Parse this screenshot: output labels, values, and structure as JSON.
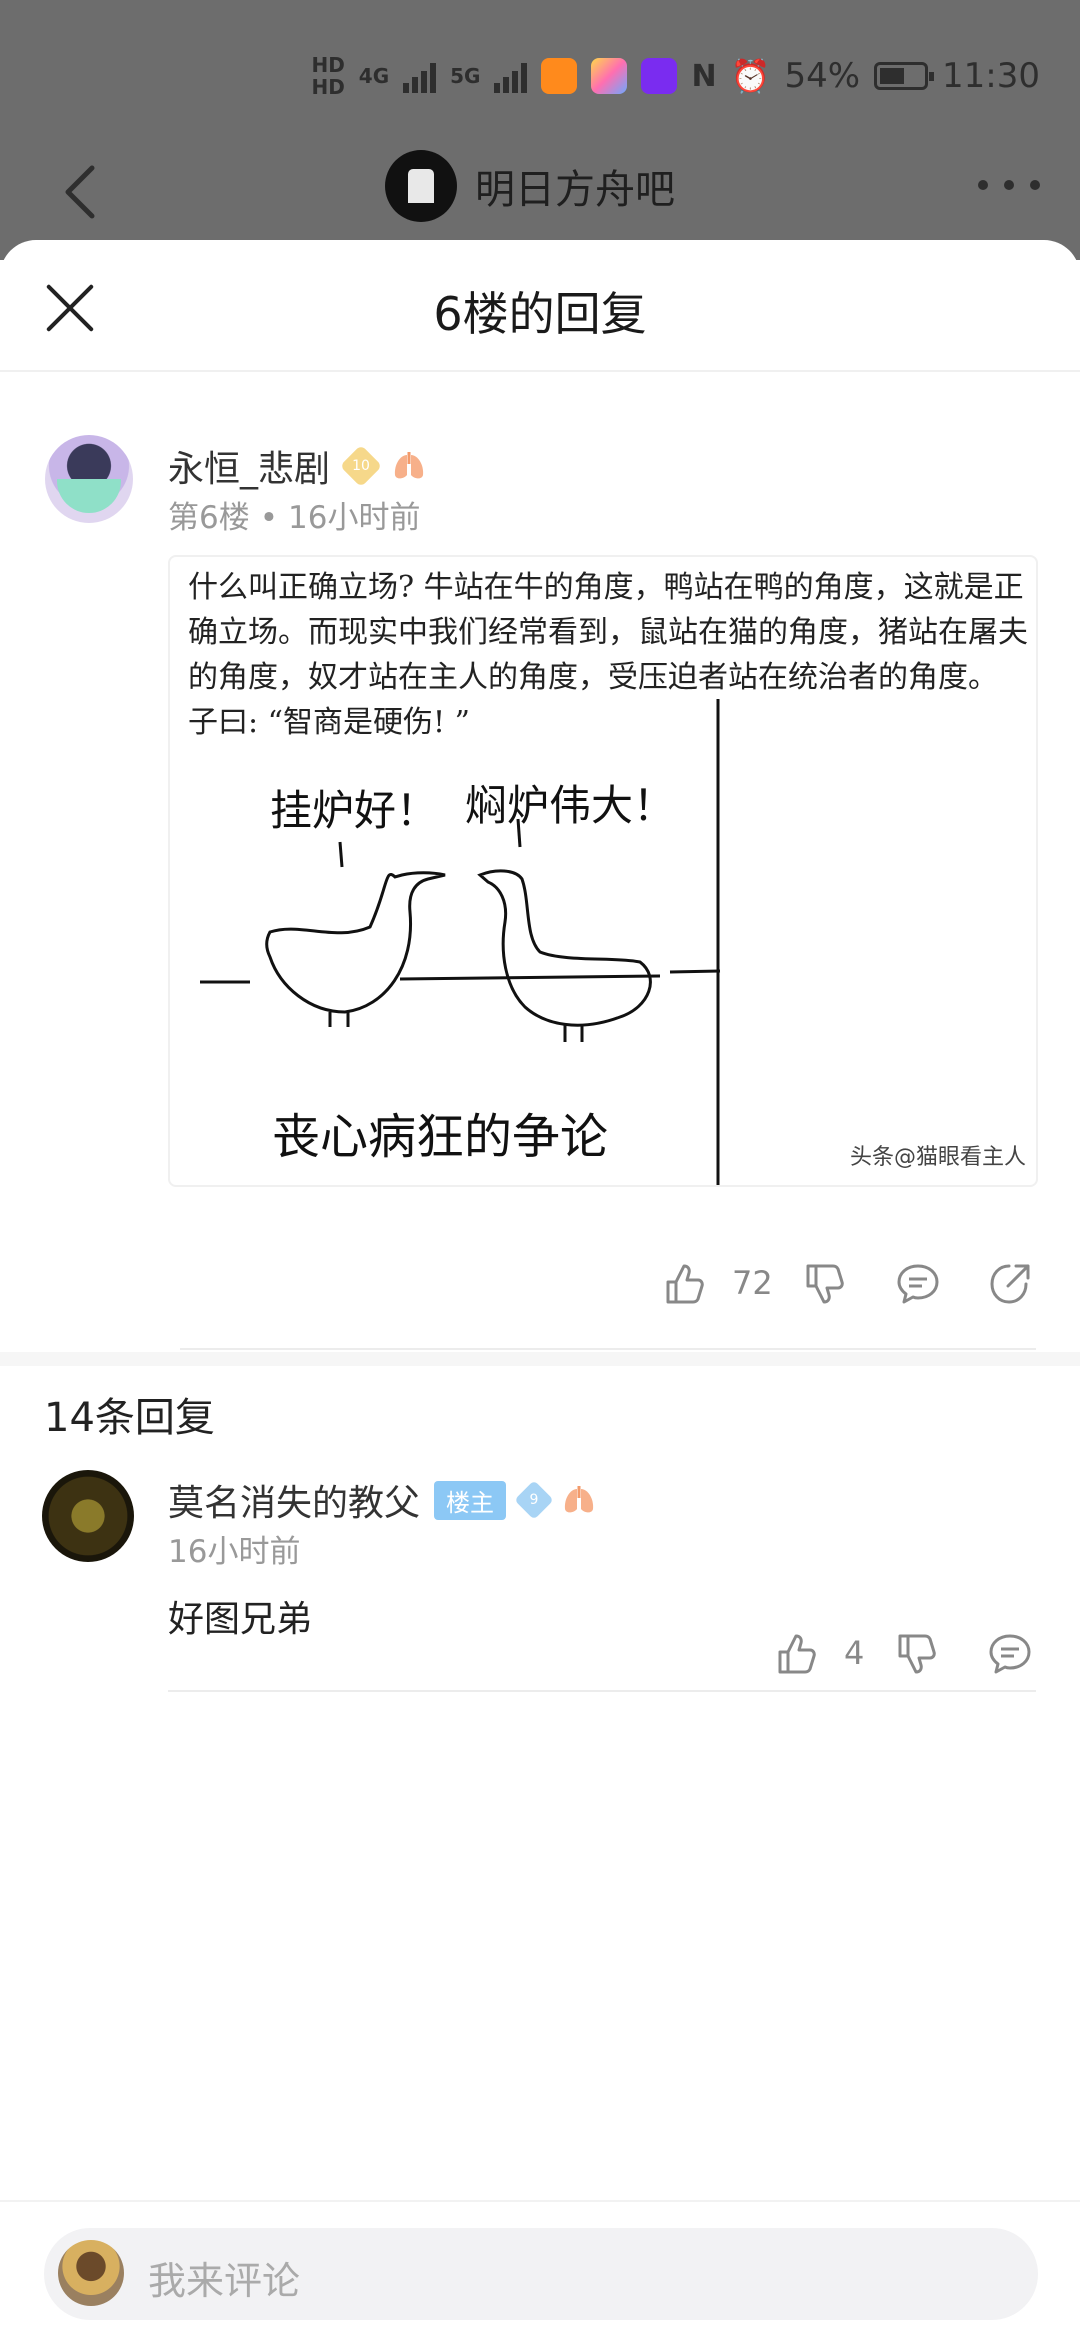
{
  "status": {
    "hd1": "HD",
    "hd2": "HD",
    "net1": "4G",
    "net2": "5G",
    "battery": "54%",
    "time": "11:30"
  },
  "background_nav": {
    "forum_name": "明日方舟吧"
  },
  "sheet": {
    "title": "6楼的回复"
  },
  "post": {
    "username": "永恒_悲剧",
    "level": "10",
    "floor": "第6楼",
    "time": "16小时前",
    "image": {
      "text": "什么叫正确立场? 牛站在牛的角度，鸭站在鸭的角度，这就是正确立场。而现实中我们经常看到，鼠站在猫的角度，猪站在屠夫的角度，奴才站在主人的角度，受压迫者站在统治者的角度。 子曰: “智商是硬伤! ”",
      "bubble_left": "挂炉好！",
      "bubble_right": "焖炉伟大！",
      "caption": "丧心病狂的争论",
      "watermark": "头条@猫眼看主人"
    },
    "likes": "72"
  },
  "replies": {
    "count_label": "14条回复",
    "items": [
      {
        "username": "莫名消失的教父",
        "owner_tag": "楼主",
        "level": "9",
        "time": "16小时前",
        "content": "好图兄弟",
        "likes": "4"
      }
    ]
  },
  "comment_bar": {
    "placeholder": "我来评论"
  }
}
